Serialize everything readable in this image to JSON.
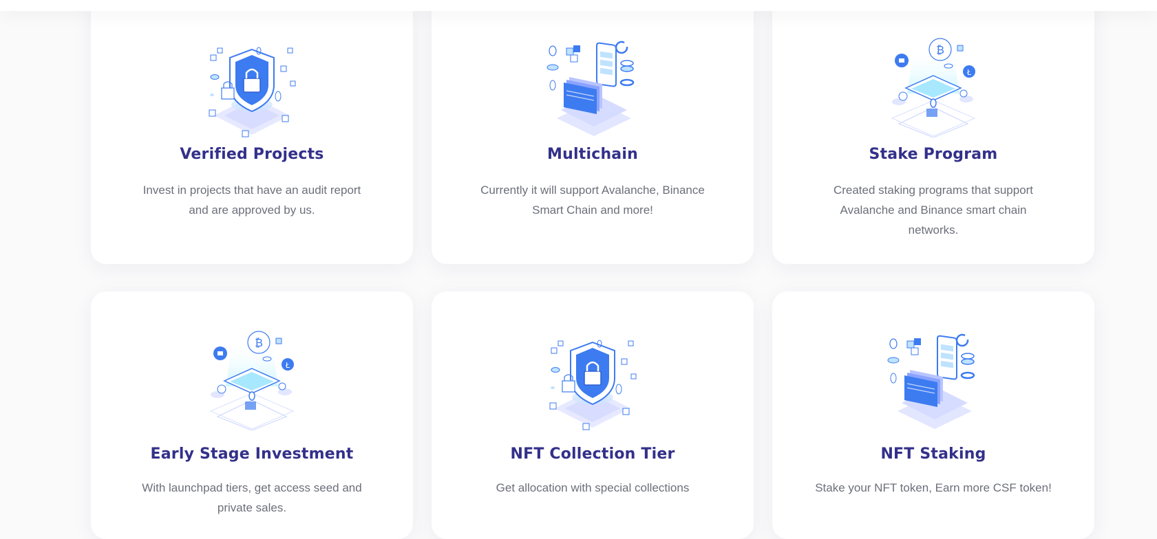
{
  "features": [
    {
      "title": "Verified Projects",
      "description": "Invest in projects that have an audit report and are approved by us.",
      "icon": "shield-lock-icon"
    },
    {
      "title": "Multichain",
      "description": "Currently it will support Avalanche, Binance Smart Chain and more!",
      "icon": "multichain-phone-icon"
    },
    {
      "title": "Stake Program",
      "description": "Created staking programs that support Avalanche and Binance smart chain networks.",
      "icon": "crypto-tablet-icon"
    },
    {
      "title": "Early Stage Investment",
      "description": "With launchpad tiers, get access seed and private sales.",
      "icon": "crypto-tablet-icon"
    },
    {
      "title": "NFT Collection Tier",
      "description": "Get allocation with special collections",
      "icon": "shield-lock-icon"
    },
    {
      "title": "NFT Staking",
      "description": "Stake your NFT token, Earn more CSF token!",
      "icon": "multichain-phone-icon"
    }
  ],
  "colors": {
    "title": "#33308a",
    "accent": "#3d7bf0",
    "text": "#6c6f7a"
  }
}
